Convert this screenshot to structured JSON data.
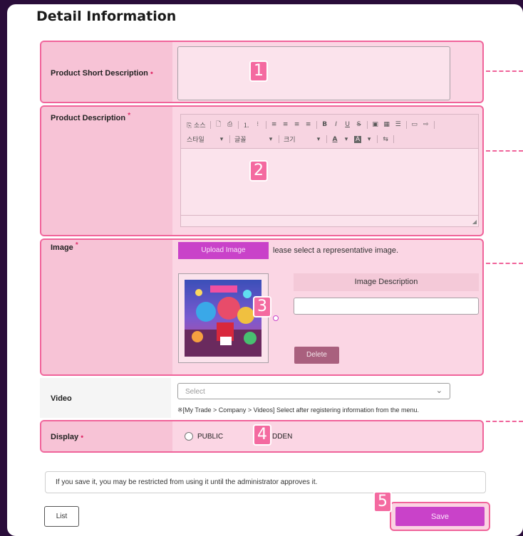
{
  "page_title": "Detail Information",
  "short_description": {
    "label": "Product Short Description",
    "required_mark": "•",
    "badge": "1"
  },
  "description": {
    "label": "Product Description",
    "required_mark": "*",
    "badge": "2",
    "toolbar_row1": [
      "⎘ 소스",
      "🗋",
      "⎙",
      "⒈",
      "⁝",
      "≡",
      "≡",
      "≡",
      "≡",
      "B",
      "I",
      "U",
      "S",
      "▣",
      "▦",
      "☰",
      "▭",
      "⇨"
    ],
    "toolbar_style_label": "스타일",
    "toolbar_format_label": "글꼴",
    "toolbar_size_label": "크기",
    "toolbar_color_a": "A",
    "toolbar_color_b": "A",
    "toolbar_extra": "⇆"
  },
  "image": {
    "label": "Image",
    "required_mark": "*",
    "badge": "3",
    "upload_button": "Upload Image",
    "hint": "lease select a representative image.",
    "desc_header": "Image Description",
    "delete_button": "Delete"
  },
  "video": {
    "label": "Video",
    "select_placeholder": "Select",
    "hint": "※[My Trade > Company > Videos] Select after registering information from the menu."
  },
  "display": {
    "label": "Display",
    "required_mark": "•",
    "badge": "4",
    "option_public": "PUBLIC",
    "option_hidden_partial": "DDEN"
  },
  "notice": "If you save it, you may be restricted from using it until the administrator approves it.",
  "buttons": {
    "list": "List",
    "save": "Save",
    "save_badge": "5"
  },
  "colors": {
    "accent": "#c942c9",
    "highlight": "#f0639a",
    "badge": "#f46aa0"
  }
}
